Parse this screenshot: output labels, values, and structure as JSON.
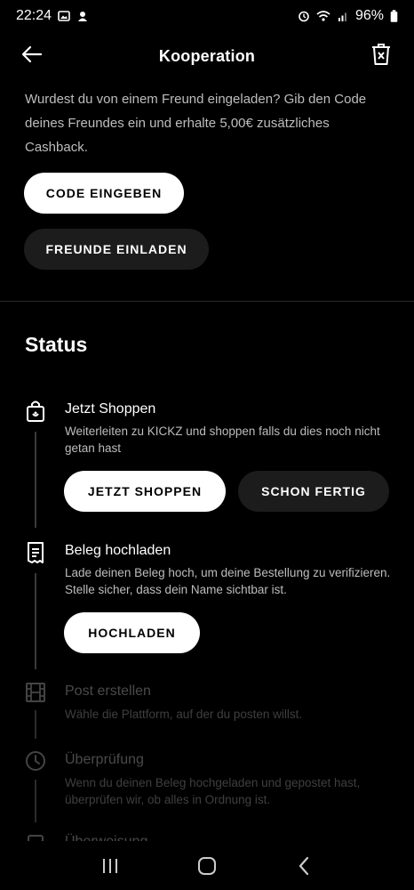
{
  "status_bar": {
    "time": "22:24",
    "battery": "96%",
    "icons": [
      "gallery-icon",
      "notification-icon",
      "alarm-icon",
      "wifi-icon",
      "signal-icon",
      "battery-icon"
    ]
  },
  "header": {
    "title": "Kooperation",
    "back_icon": "arrow-left-icon",
    "action_icon": "trash-icon"
  },
  "intro": {
    "text": "Wurdest du von einem Freund eingeladen? Gib den Code deines Freundes ein und erhalte 5,00€ zusätzliches Cashback."
  },
  "buttons": {
    "enter_code": "CODE EINGEBEN",
    "invite_friends": "FREUNDE EINLADEN"
  },
  "status": {
    "title": "Status",
    "steps": [
      {
        "icon": "shopping-bag-icon",
        "title": "Jetzt Shoppen",
        "description": "Weiterleiten zu KICKZ und shoppen falls du dies noch nicht getan hast",
        "primary_action": "JETZT SHOPPEN",
        "secondary_action": "SCHON FERTIG",
        "active": true
      },
      {
        "icon": "receipt-icon",
        "title": "Beleg hochladen",
        "description": "Lade deinen Beleg hoch, um deine Bestellung zu verifizieren. Stelle sicher, dass dein Name sichtbar ist.",
        "primary_action": "HOCHLADEN",
        "active": true
      },
      {
        "icon": "film-icon",
        "title": "Post erstellen",
        "description": "Wähle die Plattform, auf der du posten willst.",
        "active": false
      },
      {
        "icon": "clock-icon",
        "title": "Überprüfung",
        "description": "Wenn du deinen Beleg hochgeladen und gepostet hast, überprüfen wir, ob alles in Ordnung ist.",
        "active": false
      },
      {
        "icon": "partial-icon",
        "title": "Überweisung",
        "active": false
      }
    ]
  },
  "nav_bar": {
    "icons": [
      "recent-apps-icon",
      "home-icon",
      "back-icon"
    ]
  }
}
